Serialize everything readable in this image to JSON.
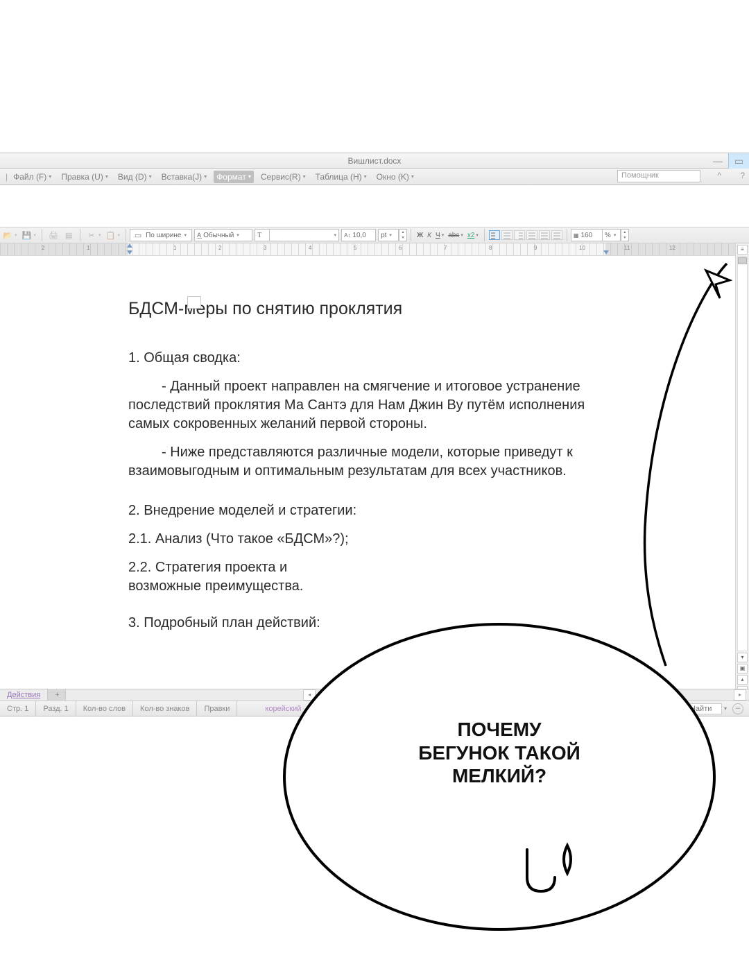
{
  "title": "Вишлист.docx",
  "window": {
    "minimize": "—",
    "restore": "▭"
  },
  "menubar": {
    "file": "Файл (F)",
    "edit": "Правка (U)",
    "view": "Вид (D)",
    "insert": "Вставка(J)",
    "format": "Формат",
    "service": "Сервис(R)",
    "table": "Таблица (H)",
    "window": "Окно (K)",
    "helper_placeholder": "Помощник",
    "caret": "^",
    "q": "?"
  },
  "toolbar": {
    "zoom_mode": "По ширине",
    "style": "Обычный",
    "font_name": "",
    "font_size_label": "10,0",
    "font_unit": "pt",
    "bold": "Ж",
    "italic": "К",
    "underline": "Ч",
    "strike": "abc",
    "super": "x2",
    "zoom_val": "160",
    "zoom_pct": "%"
  },
  "ruler": {
    "marks": [
      "2",
      "1",
      "",
      "1",
      "2",
      "3",
      "4",
      "5",
      "6",
      "7",
      "8",
      "9",
      "10",
      "11",
      "12"
    ]
  },
  "document": {
    "title": "БДСМ-меры по снятию проклятия",
    "s1_head": "1. Общая сводка:",
    "s1_p1": "- Данный проект направлен на смягчение и итоговое устранение последствий проклятия Ма Сантэ для Нам Джин Ву путём исполнения самых сокровенных желаний первой стороны.",
    "s1_p2": "- Ниже представляются различные модели, которые приведут к взаимовыгодным и оптимальным результатам для всех участников.",
    "s2_head": "2. Внедрение моделей и стратегии:",
    "s2_1": "2.1. Анализ (Что такое «БДСМ»?);",
    "s2_2": "2.2. Стратегия проекта и возможные преимущества.",
    "s3_head": "3. Подробный план действий:"
  },
  "tabs": {
    "actions": "Действия",
    "plus": "+"
  },
  "status": {
    "page": "Стр. 1",
    "section": "Разд. 1",
    "words": "Кол-во слов",
    "chars": "Кол-во знаков",
    "edits": "Правки",
    "lang": "корейский",
    "find": "Найти",
    "find_icon": "⌕"
  },
  "speech": {
    "line1": "ПОЧЕМУ",
    "line2": "БЕГУНОК ТАКОЙ",
    "line3": "МЕЛКИЙ?"
  }
}
